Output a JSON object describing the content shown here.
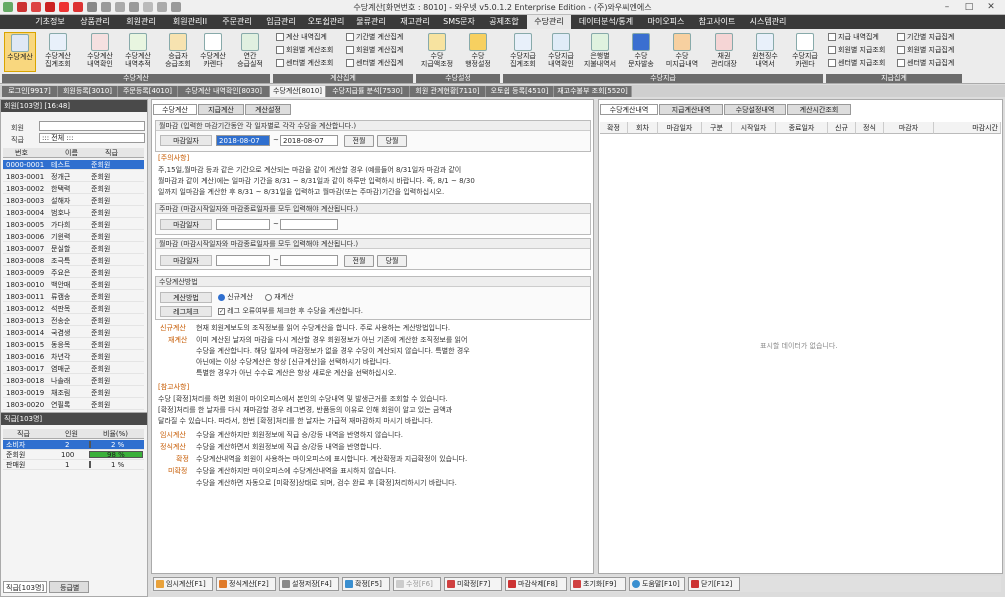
{
  "window": {
    "title": "수당계산[화면번호 : 8010] - 와우넷 v5.0.1.2 Enterprise Edition - (주)와우씨엔에스"
  },
  "menu": [
    {
      "label": "기초정보"
    },
    {
      "label": "상품관리"
    },
    {
      "label": "회원관리"
    },
    {
      "label": "회원관리II"
    },
    {
      "label": "주문관리"
    },
    {
      "label": "입금관리"
    },
    {
      "label": "오토쉽관리"
    },
    {
      "label": "물류관리"
    },
    {
      "label": "재고관리"
    },
    {
      "label": "SMS문자"
    },
    {
      "label": "공제조합"
    },
    {
      "label": "수당관리"
    },
    {
      "label": "데이터분석/통계"
    },
    {
      "label": "마이오피스"
    },
    {
      "label": "참고사이트"
    },
    {
      "label": "시스템관리"
    }
  ],
  "ribbon": {
    "group1_buttons": [
      {
        "label": "수당계산"
      },
      {
        "label": "수당계산\n집계조회"
      },
      {
        "label": "수당계산\n내역확인"
      },
      {
        "label": "수당계산\n내역추적"
      },
      {
        "label": "승급자\n승급조회"
      },
      {
        "label": "수당계산\n카렌다"
      },
      {
        "label": "연간\n승급실적"
      }
    ],
    "group1_label": "수당계산",
    "group2_items": [
      "계산 내역집계",
      "기간별 계산집계",
      "회원별 계산조회",
      "회원별 계산집계",
      "센터별 계산조회",
      "센터별 계산집계"
    ],
    "group2_label": "계산집계",
    "group3_buttons": [
      {
        "label": "수당\n지급액조정"
      },
      {
        "label": "수당\n행정설정"
      }
    ],
    "group3_label": "수당설정",
    "group4_buttons": [
      {
        "label": "수당지급\n집계조회"
      },
      {
        "label": "수당지급\n내역확인"
      },
      {
        "label": "은행별\n지불내역서"
      },
      {
        "label": "수당\n문자발송"
      },
      {
        "label": "수당\n미지급내역"
      },
      {
        "label": "채권\n관리대장"
      },
      {
        "label": "원천징수\n내역서"
      },
      {
        "label": "수당지급\n카렌다"
      }
    ],
    "group4_label": "수당지급",
    "group5_items": [
      "지급 내역집계",
      "기간별 지급집계",
      "회원별 지급조회",
      "회원별 지급집계",
      "센터별 지급조회",
      "센터별 지급집계"
    ],
    "group5_label": "지급집계"
  },
  "doc_tabs": [
    {
      "label": "로그인[9917]"
    },
    {
      "label": "회원등록[3010]"
    },
    {
      "label": "주문등록[4010]"
    },
    {
      "label": "수당계산 내역확인[8030]"
    },
    {
      "label": "수당계산[8010]"
    },
    {
      "label": "수당지급률 분석[7530]"
    },
    {
      "label": "회원 관계현황[7110]"
    },
    {
      "label": "오토쉽 등록[4510]"
    },
    {
      "label": "재고수불부 조회[5520]"
    }
  ],
  "members_panel": {
    "header": "회원[103명] [16:48]",
    "member_label": "회원",
    "rank_label": "직급",
    "rank_value": "::: 전체 :::",
    "cols": [
      "번호",
      "이름",
      "직급"
    ],
    "rows": [
      [
        "0000-0001",
        "테스트",
        "준회원"
      ],
      [
        "1803-0001",
        "정개근",
        "준회원"
      ],
      [
        "1803-0002",
        "한택력",
        "준회원"
      ],
      [
        "1803-0003",
        "설해자",
        "준회원"
      ],
      [
        "1803-0004",
        "범호나",
        "준회원"
      ],
      [
        "1803-0005",
        "가다희",
        "준회원"
      ],
      [
        "1803-0006",
        "기윈력",
        "준회원"
      ],
      [
        "1803-0007",
        "문실할",
        "준회원"
      ],
      [
        "1803-0008",
        "조극특",
        "준회원"
      ],
      [
        "1803-0009",
        "주요은",
        "준회원"
      ],
      [
        "1803-0010",
        "백안매",
        "준회원"
      ],
      [
        "1803-0011",
        "류캠송",
        "준회원"
      ],
      [
        "1803-0012",
        "석판목",
        "준회원"
      ],
      [
        "1803-0013",
        "전송순",
        "준회원"
      ],
      [
        "1803-0014",
        "국겸생",
        "준회원"
      ],
      [
        "1803-0015",
        "동응목",
        "준회원"
      ],
      [
        "1803-0016",
        "차년각",
        "준회원"
      ],
      [
        "1803-0017",
        "염매군",
        "준회원"
      ],
      [
        "1803-0018",
        "나솔래",
        "준회원"
      ],
      [
        "1803-0019",
        "채조림",
        "준회원"
      ],
      [
        "1803-0020",
        "연필록",
        "준회원"
      ]
    ]
  },
  "rank_panel": {
    "header": "직급[103명]",
    "cols": [
      "직급",
      "인원",
      "비율(%)"
    ],
    "rows": [
      {
        "rank": "소비자",
        "count": "2",
        "pct_text": "2 %",
        "pct": 2
      },
      {
        "rank": "준회원",
        "count": "100",
        "pct_text": "98 %",
        "pct": 98
      },
      {
        "rank": "판매원",
        "count": "1",
        "pct_text": "1 %",
        "pct": 1
      }
    ],
    "tabs": [
      {
        "label": "직급[103명]"
      },
      {
        "label": "등급별"
      }
    ]
  },
  "center": {
    "tabs": [
      {
        "label": "수당계산"
      },
      {
        "label": "지급계산"
      },
      {
        "label": "계산설정"
      }
    ],
    "monthly": {
      "title": "월마감 (입력한 마감기간동안 각 일자별로 각각 수당을 계산합니다.)",
      "period_label": "마감일자",
      "from": "2018-08-07",
      "to": "2018-08-07",
      "btn_prev": "전월",
      "btn_cur": "당월"
    },
    "notice": {
      "title": "[주의사항]",
      "lines": [
        "주,15일,월마감 등과 같은 기간으로 계산되는 마감을 같이 계산할 경우 (예를들어 8/31일자 마감과 같이",
        "월마감과 같이 계산)에는 일마감 기간을 8/31 ~ 8/31일과 같이 하루만 입력하시 바랍니다. 즉, 8/1 ~ 8/30",
        "일까지 일마감을 계산한 후 8/31 ~ 8/31일을 입력하고 월마감(또는 주마감)기간을 입력하십시오."
      ]
    },
    "weekly": {
      "title": "주마감 (마감시작일자와 마감종료일자를 모두 입력해야 계산됩니다.)",
      "period_label": "마감일자"
    },
    "monthly2": {
      "title": "월마감 (마감시작일자와 마감종료일자를 모두 입력해야 계산됩니다.)",
      "period_label": "마감일자",
      "btn_prev": "전월",
      "btn_cur": "당월"
    },
    "method": {
      "title": "수당계산방법",
      "calc_label": "계산방법",
      "opt_new": "신규계산",
      "opt_re": "재계산",
      "log_label": "레그체크",
      "log_text": "레그 오류여부를 체크한 후 수당을 계산합니다."
    },
    "desc": {
      "new_kw": "신규계산",
      "new_line": "현재 회원계보도의 조직정보를 읽어 수당계산을 합니다. 주로 사용하는 계산방법입니다.",
      "re_kw": "재계산",
      "re_lines": [
        "이미 계산된 날자의 마감을 다시 계산할 경우 회원정보가 아닌 기존에 계산한 조직정보를 읽어",
        "수당을 계산합니다. 해당 일자에 마감정보가 없을 경우 수당이 계산되지 않습니다. 특별한 경우",
        "아닌에는 이상 수당계산은 항상 [신규계산]을 선택하시기 바랍니다.",
        "특별한 경우가 아닌 수수료 계산은 항상 새로운 계산을 선택하십시오."
      ]
    },
    "ref": {
      "title": "[참고사항]",
      "lines": [
        "수당 [확정]처리를 하면 회원이 마이오피스에서 본인의 수당내역 및 발생근거를 조회할 수 있습니다.",
        "[확정]처리를 한 날자를 다시 재마감할 경우 레그변경, 반품등의 이유로 인해 회원이 알고 있는 금액과",
        "달라질 수 있습니다. 따라서, 한번 [확정]처리를 한 날자는 가급적 재마감하지 마시기 바랍니다."
      ],
      "items": [
        {
          "kw": "임시계산",
          "text": "수당을 계산하지만 회원정보에 직급 승/강등 내역을 반영하지 않습니다."
        },
        {
          "kw": "정식계산",
          "text": "수당을 계산하면서 회원정보에 직급 승/강등 내역을 반영합니다."
        },
        {
          "kw": "확정",
          "text": "수당계산내역을 회원이 사용하는 마이오피스에 표시합니다. 계산확정과 지급확정이 있습니다."
        },
        {
          "kw": "미확정",
          "text": "수당을 계산하지만 마이오피스에 수당계산내역을 표시하지 않습니다."
        },
        {
          "kw": "",
          "text": "수당을 계산하면 자동으로 [미확정]상태로 되며, 검수 완료 후 [확정]처리하시기 바랍니다."
        }
      ]
    }
  },
  "right": {
    "tabs": [
      {
        "label": "수당계산내역"
      },
      {
        "label": "지급계산내역"
      },
      {
        "label": "수당설정내역"
      },
      {
        "label": "계산시간조회"
      }
    ],
    "cols": [
      "확정",
      "회차",
      "마감일자",
      "구분",
      "시작일자",
      "종료일자",
      "신규",
      "정식",
      "마감자",
      "마감시간"
    ],
    "empty": "표시할 데이터가 없습니다."
  },
  "bottom_buttons": [
    {
      "label": "임시계산[F1]"
    },
    {
      "label": "정식계산[F2]"
    },
    {
      "label": "설정저장[F4]"
    },
    {
      "label": "확정[F5]"
    },
    {
      "label": "수정[F6]"
    },
    {
      "label": "미확정[F7]"
    },
    {
      "label": "마감삭제[F8]"
    },
    {
      "label": "초기화[F9]"
    },
    {
      "label": "도움말[F10]"
    },
    {
      "label": "닫기[F12]"
    }
  ],
  "colors": {
    "accent": "#f9d77e",
    "selection": "#2f6fcf",
    "menu_bg": "#3a3a3a",
    "keyword": "#c65a00"
  }
}
